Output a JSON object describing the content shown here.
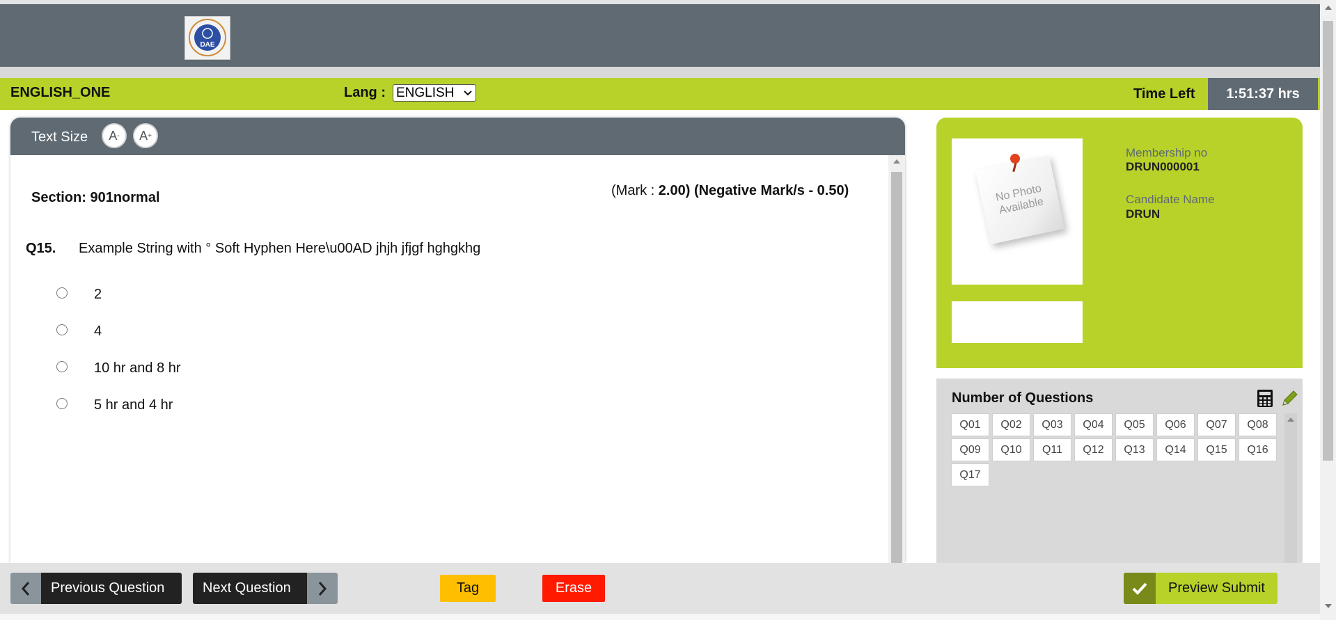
{
  "header": {
    "test_name": "ENGLISH_ONE",
    "lang_label": "Lang :",
    "lang_selected": "ENGLISH",
    "time_left_label": "Time Left",
    "time_left_value": "1:51:37 hrs",
    "logo_text": "DAE"
  },
  "question_panel": {
    "text_size_label": "Text Size",
    "decrease_label": "A-",
    "increase_label": "A+",
    "section": "Section: 901normal",
    "mark_prefix": "(Mark : ",
    "mark_value": "2.00)",
    "negative_mark": "(Negative Mark/s - 0.50)",
    "question_number": "Q15.",
    "question_text": "Example  String with ° Soft Hyphen Here\\u00AD jhjh jfjgf  hghgkhg",
    "options": [
      "2",
      "4",
      "10 hr and 8 hr",
      "5 hr and 4 hr"
    ]
  },
  "candidate": {
    "photo_placeholder": "No Photo Available",
    "membership_label": "Membership no",
    "membership_value": "DRUN000001",
    "name_label": "Candidate Name",
    "name_value": "DRUN"
  },
  "question_grid": {
    "title": "Number of Questions",
    "items": [
      "Q01",
      "Q02",
      "Q03",
      "Q04",
      "Q05",
      "Q06",
      "Q07",
      "Q08",
      "Q09",
      "Q10",
      "Q11",
      "Q12",
      "Q13",
      "Q14",
      "Q15",
      "Q16",
      "Q17"
    ]
  },
  "footer": {
    "previous_label": "Previous Question",
    "next_label": "Next Question",
    "tag_label": "Tag",
    "erase_label": "Erase",
    "preview_submit_label": "Preview Submit"
  },
  "colors": {
    "header_gray": "#5f6a73",
    "accent_green": "#b8d22a",
    "tag_yellow": "#ffbf00",
    "erase_red": "#ff1a00"
  },
  "icons": [
    "logo-icon",
    "select-chevron-icon",
    "calculator-icon",
    "pencil-icon",
    "chevron-left-icon",
    "chevron-right-icon",
    "checkmark-icon",
    "pushpin-icon"
  ]
}
